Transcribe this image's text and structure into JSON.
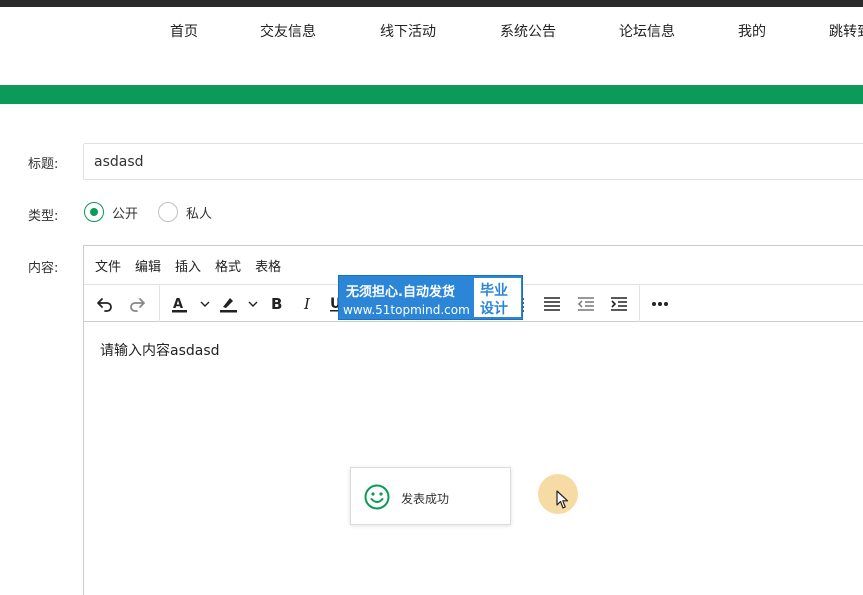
{
  "nav": {
    "items": [
      {
        "label": "首页"
      },
      {
        "label": "交友信息"
      },
      {
        "label": "线下活动"
      },
      {
        "label": "系统公告"
      },
      {
        "label": "论坛信息"
      },
      {
        "label": "我的"
      },
      {
        "label": "跳转到"
      }
    ]
  },
  "form": {
    "title_label": "标题:",
    "title_value": "asdasd",
    "type_label": "类型:",
    "type_options": [
      {
        "label": "公开",
        "checked": true
      },
      {
        "label": "私人",
        "checked": false
      }
    ],
    "content_label": "内容:"
  },
  "editor": {
    "menus": [
      "文件",
      "编辑",
      "插入",
      "格式",
      "表格"
    ],
    "content": "请输入内容asdasd",
    "toolbar_icons": [
      "undo-icon",
      "redo-icon",
      "font-color-icon",
      "highlight-icon",
      "bold-icon",
      "italic-icon",
      "underline-icon",
      "align-justify-icon",
      "align-full-icon",
      "outdent-icon",
      "indent-icon",
      "more-icon"
    ]
  },
  "watermark": {
    "line1": "无须担心.自动发货",
    "line2": "www.51topmind.com",
    "box_line1": "毕业",
    "box_line2": "设计"
  },
  "toast": {
    "message": "发表成功"
  },
  "colors": {
    "brand_green": "#0c9a58",
    "watermark_blue": "#2b86d8",
    "topbar": "#2b2b2b"
  }
}
